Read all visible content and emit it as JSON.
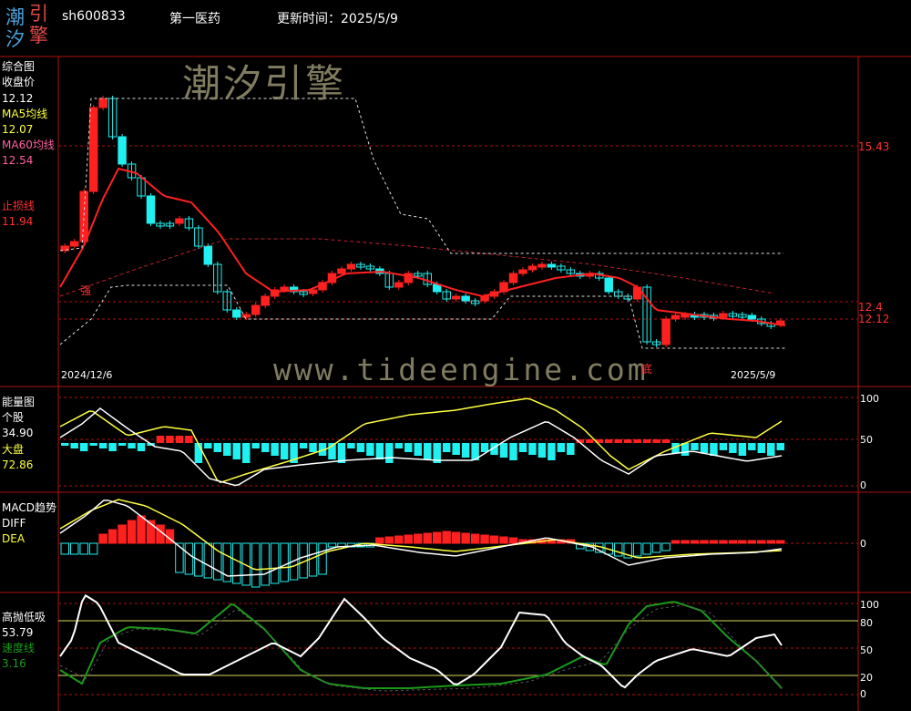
{
  "header": {
    "code": "sh600833",
    "name": "第一医药",
    "update_label": "更新时间：",
    "update_date": "2025/5/9"
  },
  "logo": {
    "chars": [
      "潮",
      "引",
      "汐",
      "擎"
    ],
    "colors": [
      "#4aa3df",
      "#e04848",
      "#4aa3df",
      "#e04848"
    ]
  },
  "watermark": {
    "cn": "潮汐引擎",
    "en": "www.tideengine.com"
  },
  "panel_main": {
    "title": "综合图",
    "close_label": "收盘价",
    "close_value": "12.12",
    "ma5_label": "MA5均线",
    "ma5_value": "12.07",
    "ma60_label": "MA60均线",
    "ma60_value": "12.54",
    "stop_label": "止损线",
    "stop_value": "11.94",
    "price_15_43": "15.43",
    "price_12_4": "12.4",
    "price_12_12": "12.12",
    "date_start": "2024/12/6",
    "date_end": "2025/5/9",
    "mark_strong": "强",
    "mark_bottom": "底"
  },
  "panel_energy": {
    "title": "能量图",
    "stock_label": "个股",
    "stock_value": "34.90",
    "market_label": "大盘",
    "market_value": "72.86",
    "ticks": [
      "100",
      "50",
      "0"
    ]
  },
  "panel_macd": {
    "title": "MACD趋势",
    "diff_label": "DIFF",
    "dea_label": "DEA",
    "tick_zero": "0"
  },
  "panel_osc": {
    "title": "高抛低吸",
    "value": "53.79",
    "speed_label": "速度线",
    "speed_value": "3.16",
    "ticks": [
      "100",
      "80",
      "50",
      "20",
      "0"
    ]
  },
  "colors": {
    "up": "#ff2020",
    "down": "#20f0f0",
    "grid": "#b01010",
    "ma": "#ff2020",
    "yellow": "#ffff40",
    "green": "#1a9a1a"
  }
}
